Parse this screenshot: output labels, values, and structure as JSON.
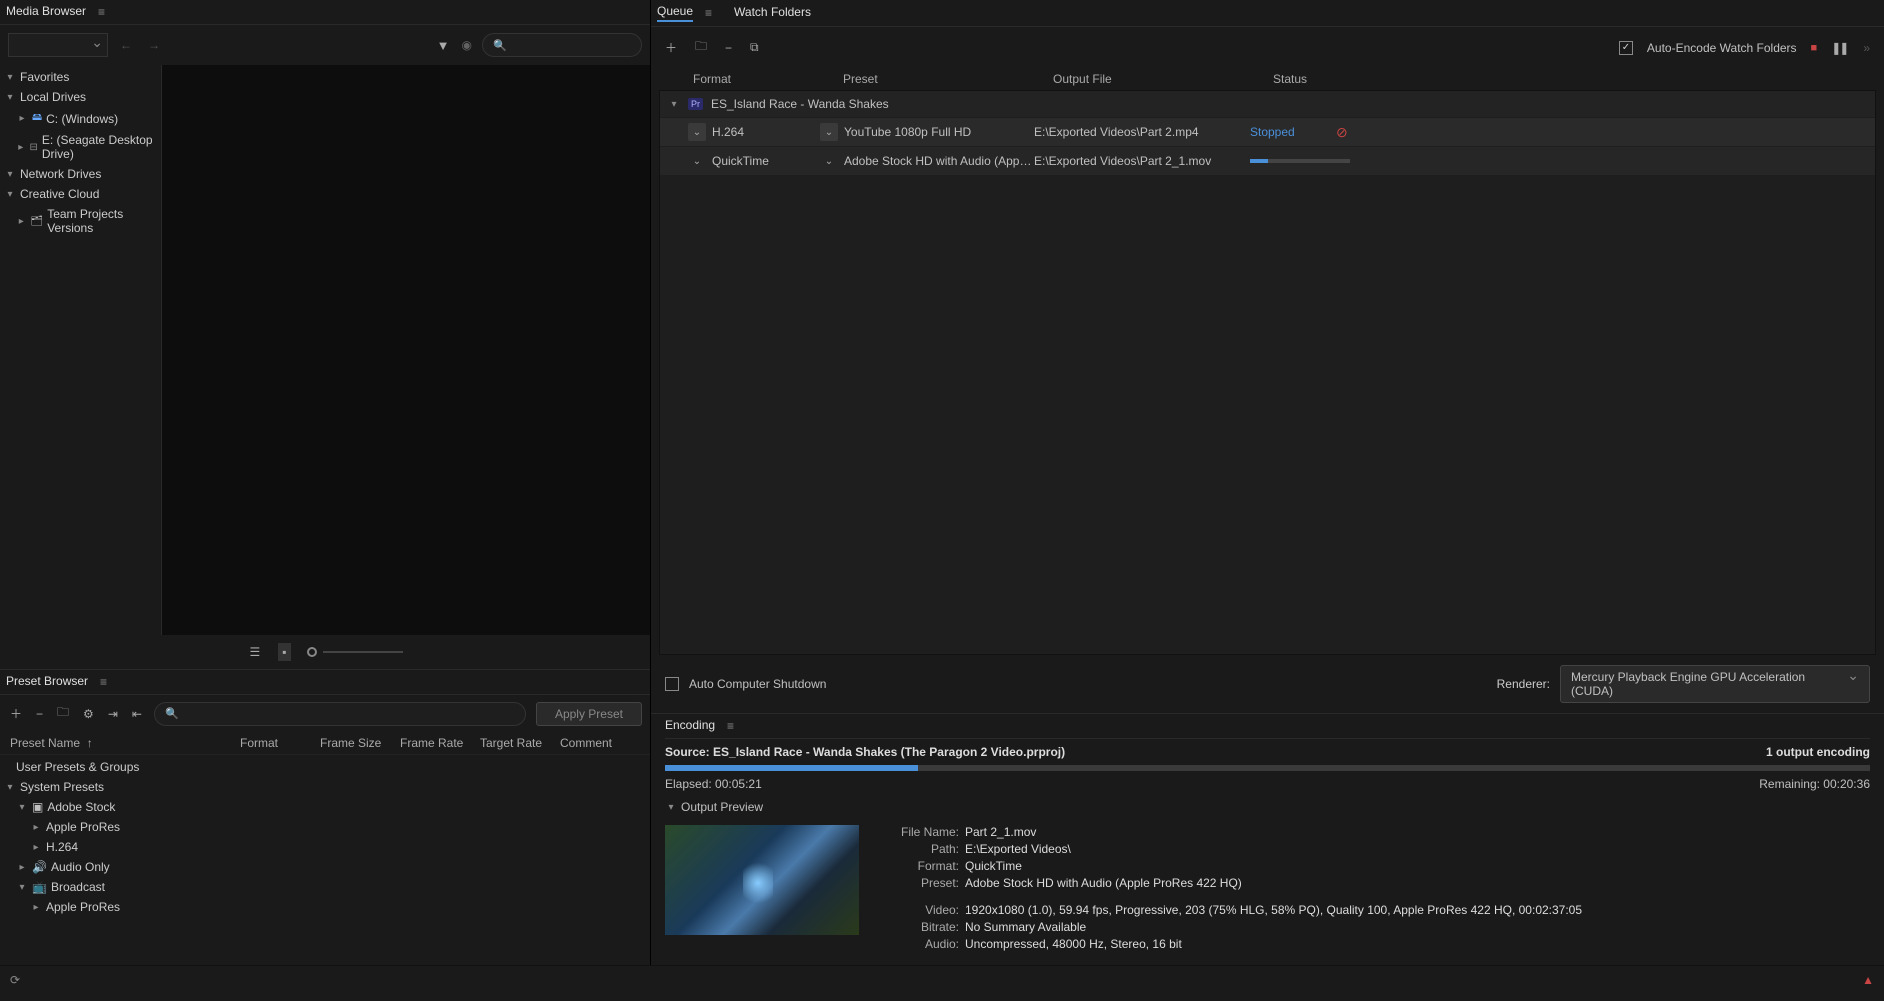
{
  "mediaBrowser": {
    "title": "Media Browser",
    "searchPlaceholder": "",
    "tree": {
      "favorites": "Favorites",
      "localDrives": "Local Drives",
      "cDrive": "C: (Windows)",
      "eDrive": "E: (Seagate Desktop Drive)",
      "networkDrives": "Network Drives",
      "creativeCloud": "Creative Cloud",
      "teamProjects": "Team Projects Versions"
    }
  },
  "presetBrowser": {
    "title": "Preset Browser",
    "applyBtn": "Apply Preset",
    "cols": {
      "name": "Preset Name",
      "format": "Format",
      "frameSize": "Frame Size",
      "frameRate": "Frame Rate",
      "targetRate": "Target Rate",
      "comment": "Comment"
    },
    "tree": {
      "userPresets": "User Presets & Groups",
      "systemPresets": "System Presets",
      "adobeStock": "Adobe Stock",
      "appleProRes1": "Apple ProRes",
      "h264": "H.264",
      "audioOnly": "Audio Only",
      "broadcast": "Broadcast",
      "appleProRes2": "Apple ProRes"
    }
  },
  "queue": {
    "tab1": "Queue",
    "tab2": "Watch Folders",
    "autoEncode": "Auto-Encode Watch Folders",
    "cols": {
      "format": "Format",
      "preset": "Preset",
      "outputFile": "Output File",
      "status": "Status"
    },
    "job": {
      "title": "ES_Island Race - Wanda Shakes",
      "rows": [
        {
          "format": "H.264",
          "preset": "YouTube 1080p Full HD",
          "output": "E:\\Exported Videos\\Part 2.mp4",
          "status": "Stopped"
        },
        {
          "format": "QuickTime",
          "preset": "Adobe Stock HD with Audio (Apple ProRes...",
          "output": "E:\\Exported Videos\\Part 2_1.mov",
          "status": ""
        }
      ]
    },
    "autoShutdown": "Auto Computer Shutdown",
    "rendererLabel": "Renderer:",
    "renderer": "Mercury Playback Engine GPU Acceleration (CUDA)"
  },
  "encoding": {
    "title": "Encoding",
    "sourceLabel": "Source: ES_Island Race - Wanda Shakes (The Paragon 2 Video.prproj)",
    "outputCount": "1 output encoding",
    "elapsed": "Elapsed: 00:05:21",
    "remaining": "Remaining: 00:20:36",
    "outputPreview": "Output Preview",
    "details": {
      "fileNameK": "File Name:",
      "fileNameV": "Part 2_1.mov",
      "pathK": "Path:",
      "pathV": "E:\\Exported Videos\\",
      "formatK": "Format:",
      "formatV": "QuickTime",
      "presetK": "Preset:",
      "presetV": "Adobe Stock HD with Audio (Apple ProRes 422 HQ)",
      "videoK": "Video:",
      "videoV": "1920x1080 (1.0), 59.94 fps, Progressive, 203 (75% HLG, 58% PQ), Quality 100, Apple ProRes 422 HQ, 00:02:37:05",
      "bitrateK": "Bitrate:",
      "bitrateV": "No Summary Available",
      "audioK": "Audio:",
      "audioV": "Uncompressed, 48000 Hz, Stereo, 16 bit"
    }
  }
}
